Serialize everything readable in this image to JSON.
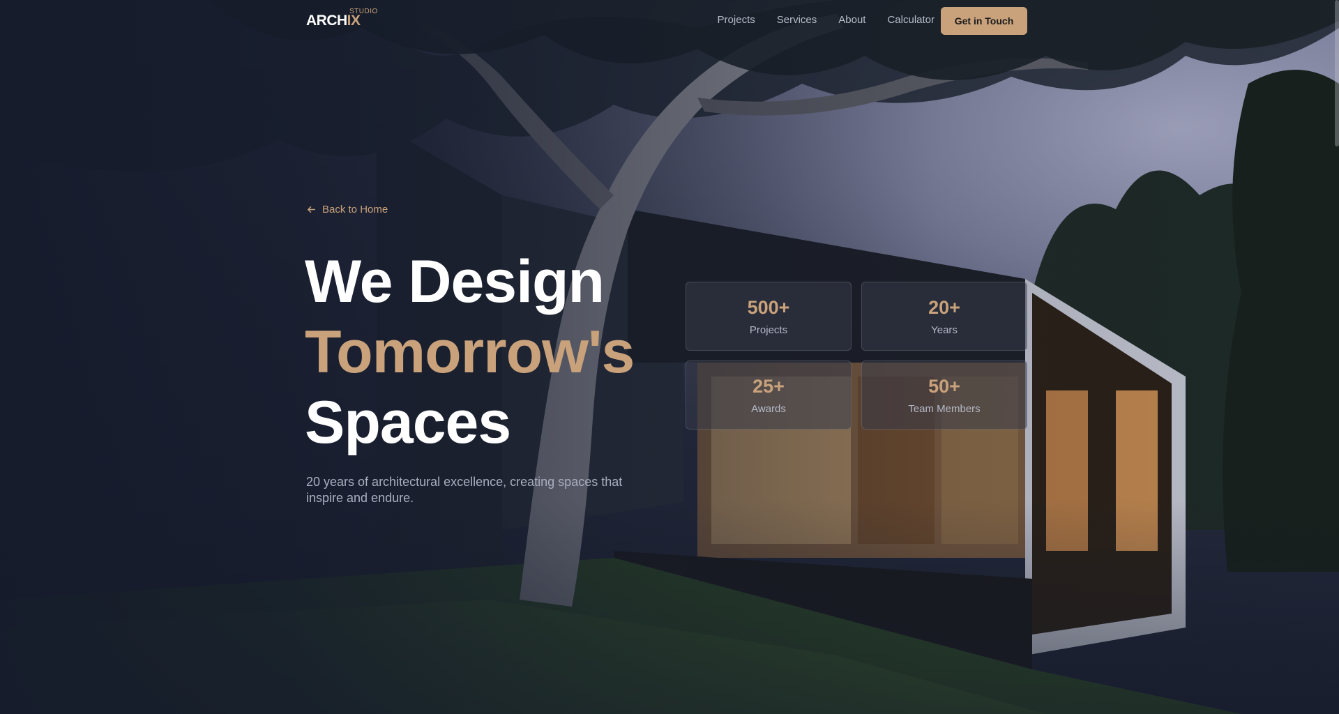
{
  "brand": {
    "name_main": "ARCH",
    "name_accent": "IX",
    "tag": "STUDIO"
  },
  "nav": {
    "links": [
      "Projects",
      "Services",
      "About",
      "Calculator"
    ],
    "cta": "Get in Touch"
  },
  "hero": {
    "back_link": "Back to Home",
    "headline_line1": "We Design",
    "headline_line2": "Tomorrow's",
    "headline_line3": "Spaces",
    "subtitle": "20 years of architectural excellence, creating spaces that inspire and endure."
  },
  "stats": [
    {
      "value": "500+",
      "label": "Projects"
    },
    {
      "value": "20+",
      "label": "Years"
    },
    {
      "value": "25+",
      "label": "Awards"
    },
    {
      "value": "50+",
      "label": "Team Members"
    }
  ],
  "colors": {
    "accent": "#c9a27c",
    "background": "#151b2b",
    "text_muted": "#a9aec0"
  }
}
